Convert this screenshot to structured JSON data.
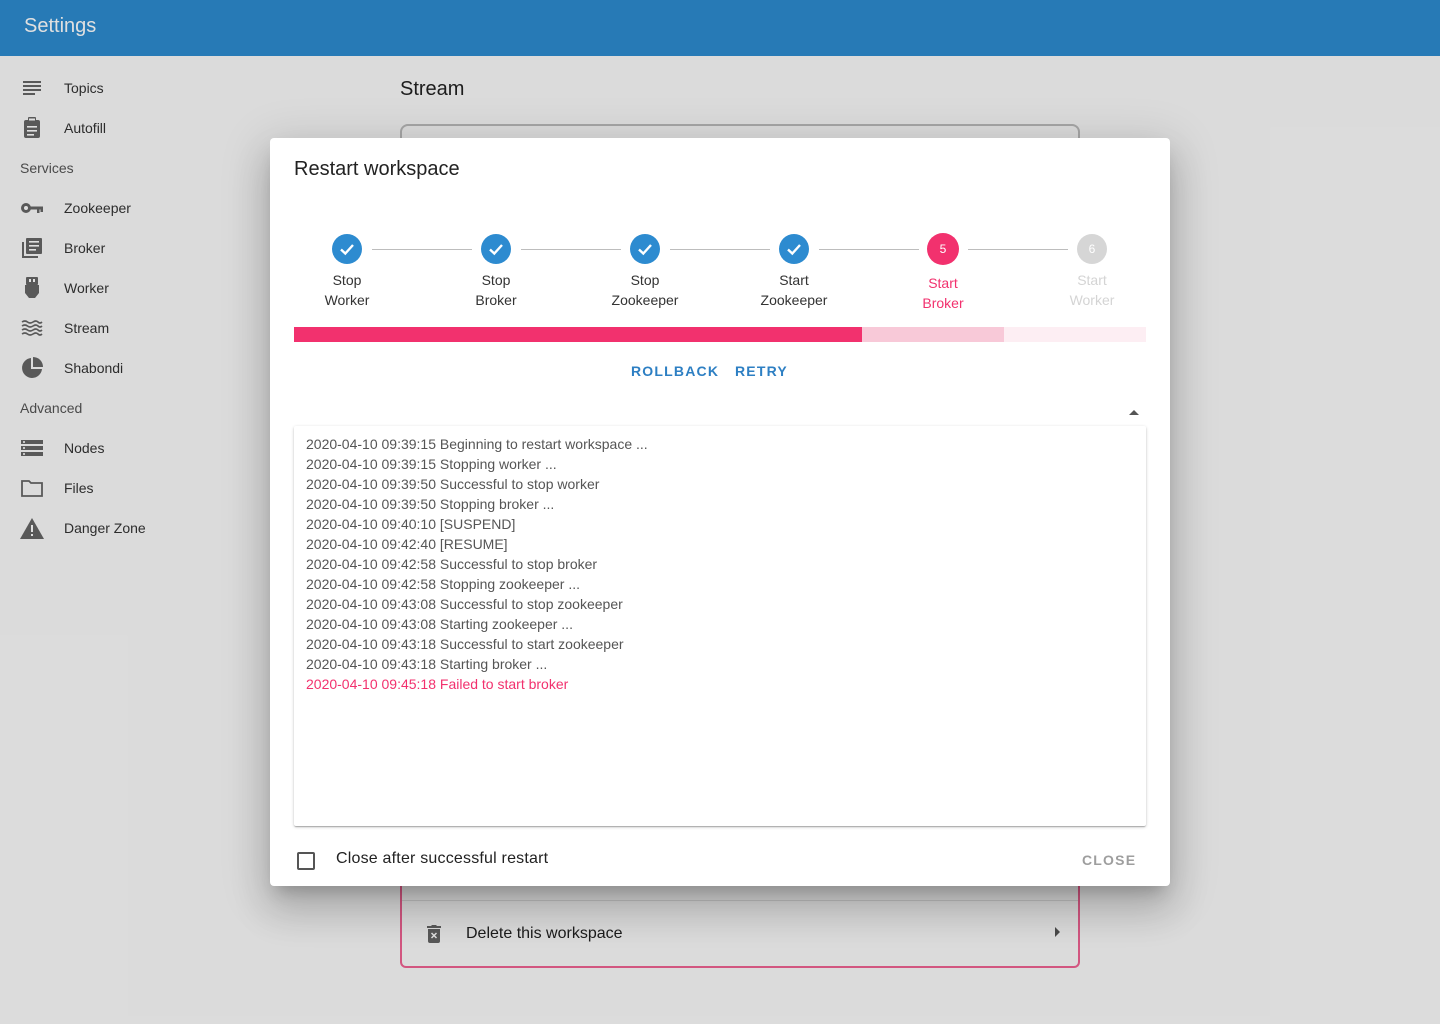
{
  "appbar": {
    "title": "Settings"
  },
  "sidebar": {
    "items_top": [
      {
        "label": "Topics",
        "icon": "topics-icon"
      },
      {
        "label": "Autofill",
        "icon": "clipboard-icon"
      }
    ],
    "section_services": "Services",
    "items_services": [
      {
        "label": "Zookeeper",
        "icon": "key-icon"
      },
      {
        "label": "Broker",
        "icon": "library-icon"
      },
      {
        "label": "Worker",
        "icon": "usb-icon"
      },
      {
        "label": "Stream",
        "icon": "waves-icon"
      },
      {
        "label": "Shabondi",
        "icon": "pie-icon"
      }
    ],
    "section_advanced": "Advanced",
    "items_advanced": [
      {
        "label": "Nodes",
        "icon": "storage-icon"
      },
      {
        "label": "Files",
        "icon": "folder-icon"
      },
      {
        "label": "Danger Zone",
        "icon": "warning-icon"
      }
    ]
  },
  "main": {
    "title": "Stream",
    "danger": {
      "delete_label": "Delete this workspace"
    }
  },
  "dialog": {
    "title": "Restart workspace",
    "steps": [
      {
        "line1": "Stop",
        "line2": "Worker",
        "status": "done"
      },
      {
        "line1": "Stop",
        "line2": "Broker",
        "status": "done"
      },
      {
        "line1": "Stop",
        "line2": "Zookeeper",
        "status": "done"
      },
      {
        "line1": "Start",
        "line2": "Zookeeper",
        "status": "done"
      },
      {
        "line1": "Start",
        "line2": "Broker",
        "status": "error",
        "number": "5"
      },
      {
        "line1": "Start",
        "line2": "Worker",
        "status": "pending",
        "number": "6"
      }
    ],
    "progress": {
      "value": 0.667,
      "buffer": 0.833
    },
    "actions": {
      "rollback": "ROLLBACK",
      "retry": "RETRY"
    },
    "log": [
      {
        "text": "2020-04-10 09:39:15 Beginning to restart workspace ...",
        "error": false
      },
      {
        "text": "2020-04-10 09:39:15 Stopping worker ...",
        "error": false
      },
      {
        "text": "2020-04-10 09:39:50 Successful to stop worker",
        "error": false
      },
      {
        "text": "2020-04-10 09:39:50 Stopping broker ...",
        "error": false
      },
      {
        "text": "2020-04-10 09:40:10 [SUSPEND]",
        "error": false
      },
      {
        "text": "2020-04-10 09:42:40 [RESUME]",
        "error": false
      },
      {
        "text": "2020-04-10 09:42:58 Successful to stop broker",
        "error": false
      },
      {
        "text": "2020-04-10 09:42:58 Stopping zookeeper ...",
        "error": false
      },
      {
        "text": "2020-04-10 09:43:08 Successful to stop zookeeper",
        "error": false
      },
      {
        "text": "2020-04-10 09:43:08 Starting zookeeper ...",
        "error": false
      },
      {
        "text": "2020-04-10 09:43:18 Successful to start zookeeper",
        "error": false
      },
      {
        "text": "2020-04-10 09:43:18 Starting broker ...",
        "error": false
      },
      {
        "text": "2020-04-10 09:45:18 Failed to start broker",
        "error": true
      }
    ],
    "checkbox_label": "Close after successful restart",
    "checkbox_checked": false,
    "close_label": "CLOSE"
  },
  "colors": {
    "primary": "#2d8bd0",
    "error": "#f2316e",
    "disabled": "#9e9e9e"
  }
}
